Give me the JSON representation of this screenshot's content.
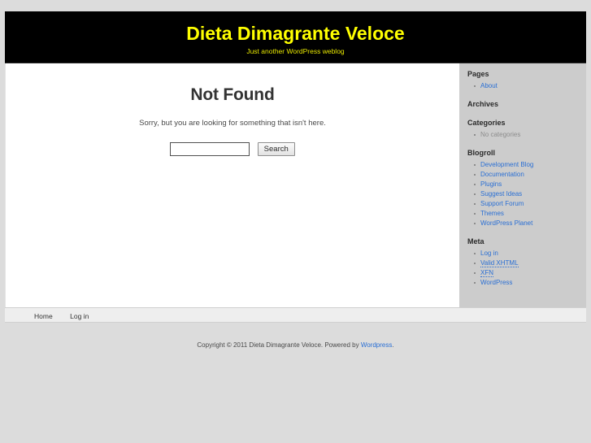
{
  "header": {
    "blog_title": "Dieta Dimagrante Veloce",
    "blog_description": "Just another WordPress weblog",
    "title_color": "#ffff00",
    "background_color": "#000000"
  },
  "content": {
    "post_title": "Not Found",
    "post_text": "Sorry, but you are looking for something that isn't here.",
    "search": {
      "value": "",
      "placeholder": "",
      "submit_label": "Search"
    }
  },
  "sidebar": {
    "widgets": [
      {
        "title": "Pages",
        "items": [
          {
            "label": "About",
            "is_link": true
          }
        ]
      },
      {
        "title": "Archives",
        "items": []
      },
      {
        "title": "Categories",
        "items": [
          {
            "label": "No categories",
            "is_link": false
          }
        ]
      },
      {
        "title": "Blogroll",
        "items": [
          {
            "label": "Development Blog",
            "is_link": true
          },
          {
            "label": "Documentation",
            "is_link": true
          },
          {
            "label": "Plugins",
            "is_link": true
          },
          {
            "label": "Suggest Ideas",
            "is_link": true
          },
          {
            "label": "Support Forum",
            "is_link": true
          },
          {
            "label": "Themes",
            "is_link": true
          },
          {
            "label": "WordPress Planet",
            "is_link": true
          }
        ]
      },
      {
        "title": "Meta",
        "items": [
          {
            "label": "Log in",
            "is_link": true
          },
          {
            "label": "Valid XHTML",
            "is_link": true,
            "dotted": true
          },
          {
            "label": "XFN",
            "is_link": true,
            "dotted": true
          },
          {
            "label": "WordPress",
            "is_link": true
          }
        ]
      }
    ]
  },
  "footer_nav": {
    "items": [
      {
        "label": "Home"
      },
      {
        "label": "Log in"
      }
    ]
  },
  "copyright": {
    "prefix": "Copyright © 2011 Dieta Dimagrante Veloce. Powered by ",
    "link_label": "Wordpress",
    "suffix": "."
  }
}
